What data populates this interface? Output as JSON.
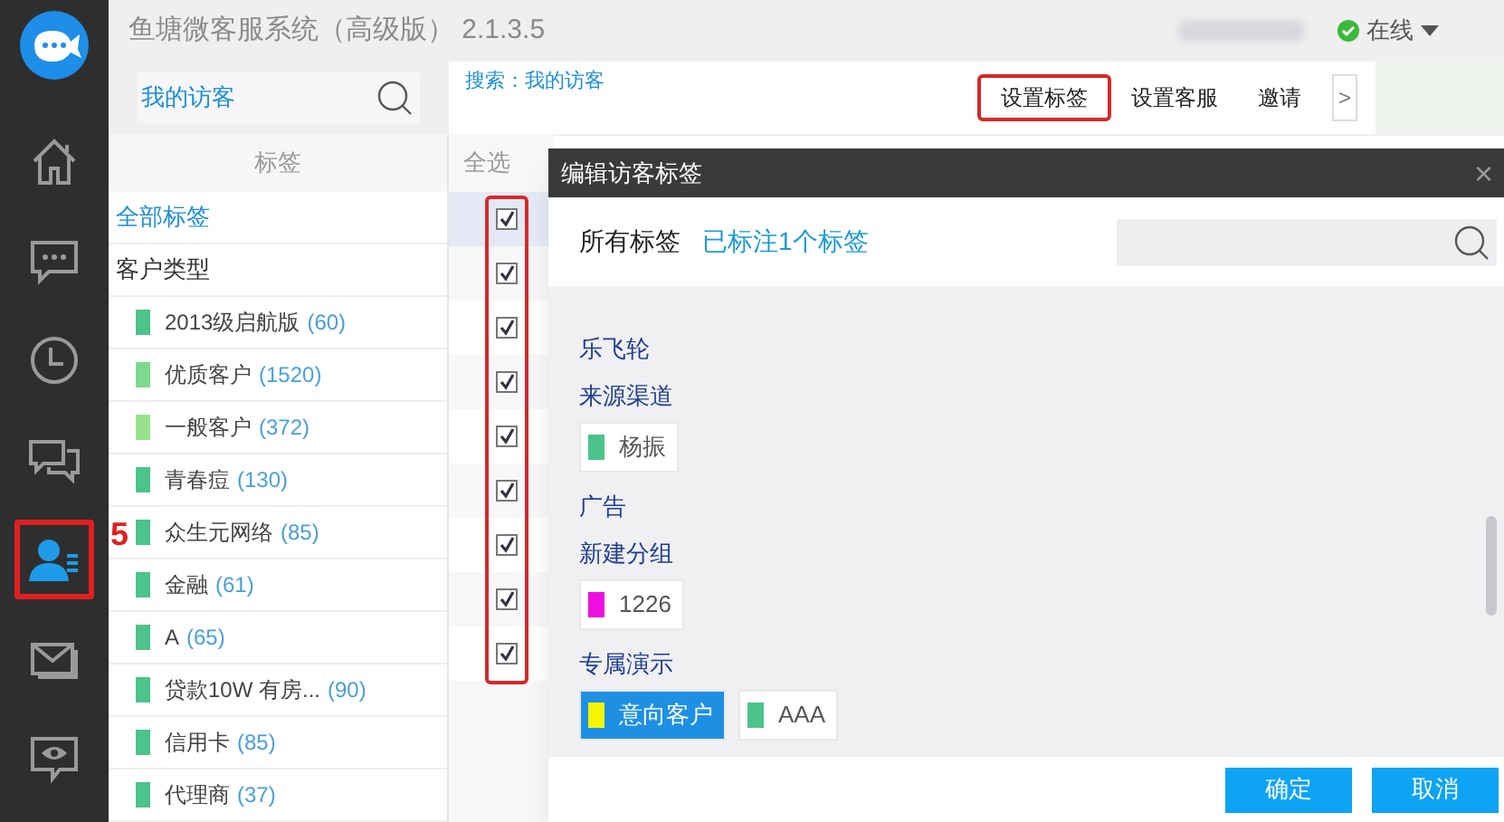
{
  "window": {
    "title": "鱼塘微客服系统（高级版） 2.1.3.5",
    "status": "在线"
  },
  "nav": [
    {
      "kind": "home",
      "selected": false
    },
    {
      "kind": "chat",
      "selected": false
    },
    {
      "kind": "clock",
      "selected": false
    },
    {
      "kind": "chats",
      "selected": false
    },
    {
      "kind": "contacts",
      "selected": true
    },
    {
      "kind": "mail",
      "selected": false
    },
    {
      "kind": "eye",
      "selected": false
    }
  ],
  "annotation": "5",
  "search": {
    "value": "我的访客",
    "breadcrumb": "搜索：我的访客"
  },
  "toolbar": [
    {
      "label": "设置标签",
      "highlighted": true
    },
    {
      "label": "设置客服",
      "highlighted": false
    },
    {
      "label": "邀请",
      "highlighted": false
    },
    {
      "label": ">",
      "highlighted": false
    }
  ],
  "tag_panel": {
    "header": "标签",
    "all": "全部标签",
    "group": "客户类型",
    "items": [
      {
        "name": "2013级启航版",
        "count": "(60)",
        "color": "#4cc38a"
      },
      {
        "name": "优质客户",
        "count": "(1520)",
        "color": "#7dd98e"
      },
      {
        "name": "一般客户",
        "count": "(372)",
        "color": "#98e28e"
      },
      {
        "name": "青春痘",
        "count": "(130)",
        "color": "#4cc38a"
      },
      {
        "name": "众生元网络",
        "count": "(85)",
        "color": "#4cc38a"
      },
      {
        "name": "金融",
        "count": "(61)",
        "color": "#4cc38a"
      },
      {
        "name": "A",
        "count": "(65)",
        "color": "#4cc38a"
      },
      {
        "name": "贷款10W 有房...",
        "count": "(90)",
        "color": "#4cc38a"
      },
      {
        "name": "信用卡",
        "count": "(85)",
        "color": "#4cc38a"
      },
      {
        "name": "代理商",
        "count": "(37)",
        "color": "#4cc38a"
      }
    ]
  },
  "table": {
    "select_all": "全选",
    "rows": [
      {
        "checked": true,
        "selected": true
      },
      {
        "checked": true,
        "selected": false
      },
      {
        "checked": true,
        "selected": false
      },
      {
        "checked": true,
        "selected": false
      },
      {
        "checked": true,
        "selected": false
      },
      {
        "checked": true,
        "selected": false
      },
      {
        "checked": true,
        "selected": false
      },
      {
        "checked": true,
        "selected": false
      },
      {
        "checked": true,
        "selected": false
      }
    ]
  },
  "dialog": {
    "title": "编辑访客标签",
    "close": "×",
    "all_tags": "所有标签",
    "marked": "已标注1个标签",
    "groups": [
      {
        "name": "乐飞轮"
      },
      {
        "name": "来源渠道",
        "tags": [
          {
            "name": "杨振",
            "color": "#4cc38a",
            "selected": false
          }
        ]
      },
      {
        "name": "广告"
      },
      {
        "name": "新建分组",
        "tags": [
          {
            "name": "1226",
            "color": "#ee10e0",
            "selected": false
          }
        ]
      },
      {
        "name": "专属演示",
        "tags": [
          {
            "name": "意向客户",
            "color": "#f5f500",
            "selected": true
          },
          {
            "name": "AAA",
            "color": "#4cc38a",
            "selected": false
          }
        ]
      }
    ],
    "buttons": [
      "确定",
      "取消"
    ]
  }
}
